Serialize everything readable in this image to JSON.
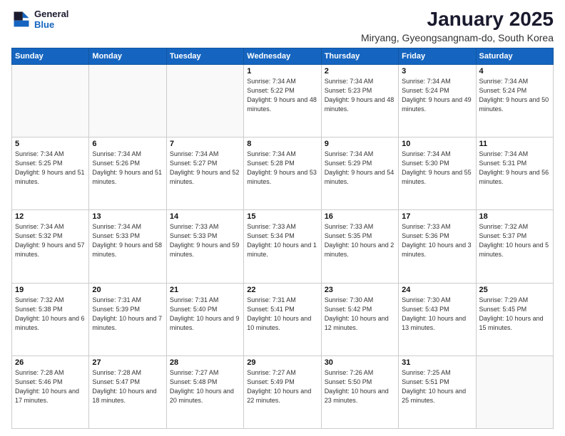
{
  "logo": {
    "line1": "General",
    "line2": "Blue"
  },
  "title": "January 2025",
  "location": "Miryang, Gyeongsangnam-do, South Korea",
  "weekdays": [
    "Sunday",
    "Monday",
    "Tuesday",
    "Wednesday",
    "Thursday",
    "Friday",
    "Saturday"
  ],
  "weeks": [
    [
      {
        "day": "",
        "sunrise": "",
        "sunset": "",
        "daylight": ""
      },
      {
        "day": "",
        "sunrise": "",
        "sunset": "",
        "daylight": ""
      },
      {
        "day": "",
        "sunrise": "",
        "sunset": "",
        "daylight": ""
      },
      {
        "day": "1",
        "sunrise": "Sunrise: 7:34 AM",
        "sunset": "Sunset: 5:22 PM",
        "daylight": "Daylight: 9 hours and 48 minutes."
      },
      {
        "day": "2",
        "sunrise": "Sunrise: 7:34 AM",
        "sunset": "Sunset: 5:23 PM",
        "daylight": "Daylight: 9 hours and 48 minutes."
      },
      {
        "day": "3",
        "sunrise": "Sunrise: 7:34 AM",
        "sunset": "Sunset: 5:24 PM",
        "daylight": "Daylight: 9 hours and 49 minutes."
      },
      {
        "day": "4",
        "sunrise": "Sunrise: 7:34 AM",
        "sunset": "Sunset: 5:24 PM",
        "daylight": "Daylight: 9 hours and 50 minutes."
      }
    ],
    [
      {
        "day": "5",
        "sunrise": "Sunrise: 7:34 AM",
        "sunset": "Sunset: 5:25 PM",
        "daylight": "Daylight: 9 hours and 51 minutes."
      },
      {
        "day": "6",
        "sunrise": "Sunrise: 7:34 AM",
        "sunset": "Sunset: 5:26 PM",
        "daylight": "Daylight: 9 hours and 51 minutes."
      },
      {
        "day": "7",
        "sunrise": "Sunrise: 7:34 AM",
        "sunset": "Sunset: 5:27 PM",
        "daylight": "Daylight: 9 hours and 52 minutes."
      },
      {
        "day": "8",
        "sunrise": "Sunrise: 7:34 AM",
        "sunset": "Sunset: 5:28 PM",
        "daylight": "Daylight: 9 hours and 53 minutes."
      },
      {
        "day": "9",
        "sunrise": "Sunrise: 7:34 AM",
        "sunset": "Sunset: 5:29 PM",
        "daylight": "Daylight: 9 hours and 54 minutes."
      },
      {
        "day": "10",
        "sunrise": "Sunrise: 7:34 AM",
        "sunset": "Sunset: 5:30 PM",
        "daylight": "Daylight: 9 hours and 55 minutes."
      },
      {
        "day": "11",
        "sunrise": "Sunrise: 7:34 AM",
        "sunset": "Sunset: 5:31 PM",
        "daylight": "Daylight: 9 hours and 56 minutes."
      }
    ],
    [
      {
        "day": "12",
        "sunrise": "Sunrise: 7:34 AM",
        "sunset": "Sunset: 5:32 PM",
        "daylight": "Daylight: 9 hours and 57 minutes."
      },
      {
        "day": "13",
        "sunrise": "Sunrise: 7:34 AM",
        "sunset": "Sunset: 5:33 PM",
        "daylight": "Daylight: 9 hours and 58 minutes."
      },
      {
        "day": "14",
        "sunrise": "Sunrise: 7:33 AM",
        "sunset": "Sunset: 5:33 PM",
        "daylight": "Daylight: 9 hours and 59 minutes."
      },
      {
        "day": "15",
        "sunrise": "Sunrise: 7:33 AM",
        "sunset": "Sunset: 5:34 PM",
        "daylight": "Daylight: 10 hours and 1 minute."
      },
      {
        "day": "16",
        "sunrise": "Sunrise: 7:33 AM",
        "sunset": "Sunset: 5:35 PM",
        "daylight": "Daylight: 10 hours and 2 minutes."
      },
      {
        "day": "17",
        "sunrise": "Sunrise: 7:33 AM",
        "sunset": "Sunset: 5:36 PM",
        "daylight": "Daylight: 10 hours and 3 minutes."
      },
      {
        "day": "18",
        "sunrise": "Sunrise: 7:32 AM",
        "sunset": "Sunset: 5:37 PM",
        "daylight": "Daylight: 10 hours and 5 minutes."
      }
    ],
    [
      {
        "day": "19",
        "sunrise": "Sunrise: 7:32 AM",
        "sunset": "Sunset: 5:38 PM",
        "daylight": "Daylight: 10 hours and 6 minutes."
      },
      {
        "day": "20",
        "sunrise": "Sunrise: 7:31 AM",
        "sunset": "Sunset: 5:39 PM",
        "daylight": "Daylight: 10 hours and 7 minutes."
      },
      {
        "day": "21",
        "sunrise": "Sunrise: 7:31 AM",
        "sunset": "Sunset: 5:40 PM",
        "daylight": "Daylight: 10 hours and 9 minutes."
      },
      {
        "day": "22",
        "sunrise": "Sunrise: 7:31 AM",
        "sunset": "Sunset: 5:41 PM",
        "daylight": "Daylight: 10 hours and 10 minutes."
      },
      {
        "day": "23",
        "sunrise": "Sunrise: 7:30 AM",
        "sunset": "Sunset: 5:42 PM",
        "daylight": "Daylight: 10 hours and 12 minutes."
      },
      {
        "day": "24",
        "sunrise": "Sunrise: 7:30 AM",
        "sunset": "Sunset: 5:43 PM",
        "daylight": "Daylight: 10 hours and 13 minutes."
      },
      {
        "day": "25",
        "sunrise": "Sunrise: 7:29 AM",
        "sunset": "Sunset: 5:45 PM",
        "daylight": "Daylight: 10 hours and 15 minutes."
      }
    ],
    [
      {
        "day": "26",
        "sunrise": "Sunrise: 7:28 AM",
        "sunset": "Sunset: 5:46 PM",
        "daylight": "Daylight: 10 hours and 17 minutes."
      },
      {
        "day": "27",
        "sunrise": "Sunrise: 7:28 AM",
        "sunset": "Sunset: 5:47 PM",
        "daylight": "Daylight: 10 hours and 18 minutes."
      },
      {
        "day": "28",
        "sunrise": "Sunrise: 7:27 AM",
        "sunset": "Sunset: 5:48 PM",
        "daylight": "Daylight: 10 hours and 20 minutes."
      },
      {
        "day": "29",
        "sunrise": "Sunrise: 7:27 AM",
        "sunset": "Sunset: 5:49 PM",
        "daylight": "Daylight: 10 hours and 22 minutes."
      },
      {
        "day": "30",
        "sunrise": "Sunrise: 7:26 AM",
        "sunset": "Sunset: 5:50 PM",
        "daylight": "Daylight: 10 hours and 23 minutes."
      },
      {
        "day": "31",
        "sunrise": "Sunrise: 7:25 AM",
        "sunset": "Sunset: 5:51 PM",
        "daylight": "Daylight: 10 hours and 25 minutes."
      },
      {
        "day": "",
        "sunrise": "",
        "sunset": "",
        "daylight": ""
      }
    ]
  ]
}
